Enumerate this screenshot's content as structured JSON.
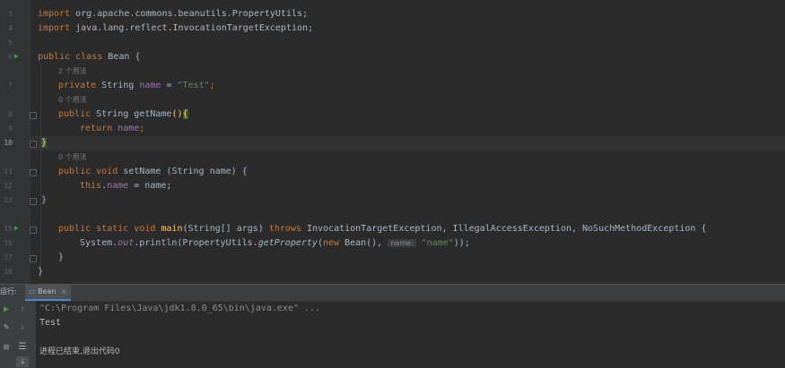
{
  "editor": {
    "line_numbers": [
      "3",
      "4",
      "5",
      "6",
      "7",
      "8",
      "9",
      "10",
      "11",
      "12",
      "13",
      "15",
      "16",
      "17",
      "18"
    ],
    "imports": {
      "kw": "import",
      "line3_path": " org.apache.commons.beanutils.PropertyUtils;",
      "line4_path": " java.lang.reflect.InvocationTargetException;"
    },
    "class_decl": {
      "kw_public": "public",
      "kw_class": " class ",
      "name": "Bean",
      "brace": " {"
    },
    "hints": {
      "usages_2": "2 个用法",
      "usages_0a": "0 个用法",
      "usages_0b": "0 个用法"
    },
    "field": {
      "kw_private": "private",
      "type": " String ",
      "name": "name",
      "eq": " = ",
      "value": "\"Test\"",
      "semi": ";"
    },
    "getter": {
      "kw_public": "public",
      "type": " String ",
      "name": "getName",
      "paren": "()",
      "brace": "{",
      "kw_return": "return",
      "ret_field": "name",
      "semi": ";",
      "close": "}"
    },
    "class_close_hl": "}",
    "setter": {
      "kw_public": "public",
      "kw_void": " void ",
      "name": "setName",
      "params": " (String name) {",
      "kw_this": "this",
      "dot": ".",
      "field": "name",
      "assign": " = name;",
      "close": "}"
    },
    "main": {
      "kw_public": "public",
      "kw_static": " static",
      "kw_void": " void ",
      "name": "main",
      "params": "(String[] args) ",
      "kw_throws": "throws",
      "exceptions": " InvocationTargetException, IllegalAccessException, NoSuchMethodException {",
      "sys": "System.",
      "out": "out",
      "println": ".println(PropertyUtils.",
      "getprop": "getProperty",
      "open": "(",
      "kw_new": "new",
      "bean_call": " Bean(), ",
      "inlay_name": "name:",
      "arg_str": "\"name\"",
      "end": "));",
      "close": "}"
    },
    "final_close": "}"
  },
  "run_panel": {
    "title": "运行:",
    "tab_label": "Bean",
    "tab_close": "×",
    "output_lines": [
      "\"C:\\Program Files\\Java\\jdk1.8.0_65\\bin\\java.exe\" ...",
      "Test",
      "",
      "进程已结束,退出代码0"
    ]
  },
  "colors": {
    "keyword": "#cc7832",
    "field": "#9876aa",
    "string": "#6a8759",
    "method": "#ffc66d",
    "text": "#a9b7c6",
    "run_green": "#499c54"
  }
}
